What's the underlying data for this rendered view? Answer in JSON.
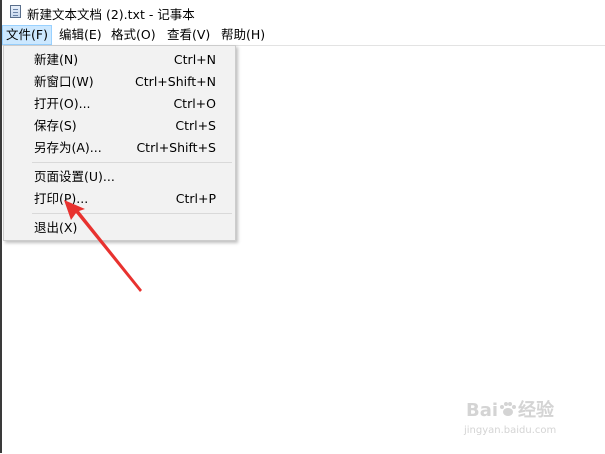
{
  "titlebar": {
    "title": "新建文本文档 (2).txt - 记事本",
    "icon": "notepad-icon"
  },
  "menubar": {
    "items": [
      {
        "label": "文件(F)",
        "active": true
      },
      {
        "label": "编辑(E)"
      },
      {
        "label": "格式(O)"
      },
      {
        "label": "查看(V)"
      },
      {
        "label": "帮助(H)"
      }
    ]
  },
  "file_menu": {
    "items": [
      {
        "label": "新建(N)",
        "shortcut": "Ctrl+N"
      },
      {
        "label": "新窗口(W)",
        "shortcut": "Ctrl+Shift+N"
      },
      {
        "label": "打开(O)...",
        "shortcut": "Ctrl+O"
      },
      {
        "label": "保存(S)",
        "shortcut": "Ctrl+S"
      },
      {
        "label": "另存为(A)...",
        "shortcut": "Ctrl+Shift+S"
      },
      {
        "label": "页面设置(U)..."
      },
      {
        "label": "打印(P)...",
        "shortcut": "Ctrl+P"
      },
      {
        "label": "退出(X)"
      }
    ]
  },
  "annotation": {
    "color": "#e8322f",
    "target": "打印(P)..."
  },
  "watermark": {
    "brand": "Bai",
    "paw": "paw-icon",
    "suffix": "经验",
    "url": "jingyan.baidu.com"
  },
  "colors": {
    "menu_highlight": "#cce8ff",
    "menu_bg": "#f2f2f2"
  }
}
